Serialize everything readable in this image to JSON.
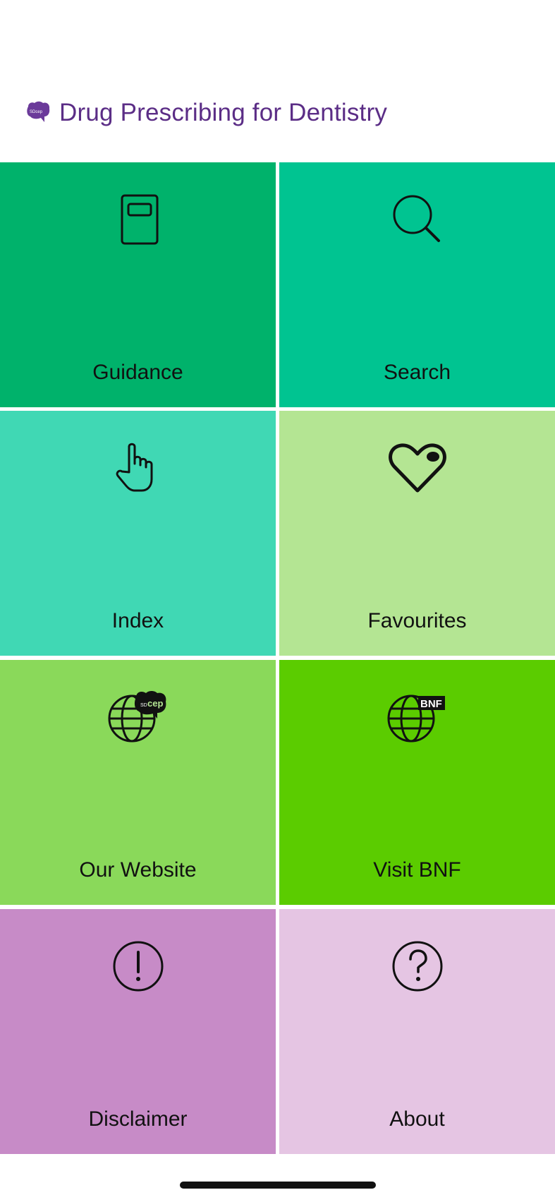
{
  "app": {
    "title": "Drug Prescribing for Dentistry",
    "logo_icon": "sdcep-logo-icon",
    "logo_text": "SDcep",
    "brand_color": "#5b2d86"
  },
  "tiles": [
    {
      "label": "Guidance",
      "icon": "book-icon",
      "color": "#00b26b"
    },
    {
      "label": "Search",
      "icon": "search-icon",
      "color": "#00c491"
    },
    {
      "label": "Index",
      "icon": "pointing-hand-icon",
      "color": "#40d8b4"
    },
    {
      "label": "Favourites",
      "icon": "heart-icon",
      "color": "#b4e593"
    },
    {
      "label": "Our Website",
      "icon": "globe-sdcep-icon",
      "color": "#8ad95a"
    },
    {
      "label": "Visit BNF",
      "icon": "globe-bnf-icon",
      "color": "#5bcc00"
    },
    {
      "label": "Disclaimer",
      "icon": "exclamation-circle-icon",
      "color": "#c78bc7"
    },
    {
      "label": "About",
      "icon": "question-circle-icon",
      "color": "#e5c5e3"
    }
  ],
  "icons": {
    "bnf_badge": "BNF",
    "sdcep_badge": "cep",
    "sdcep_badge_prefix": "SD"
  }
}
